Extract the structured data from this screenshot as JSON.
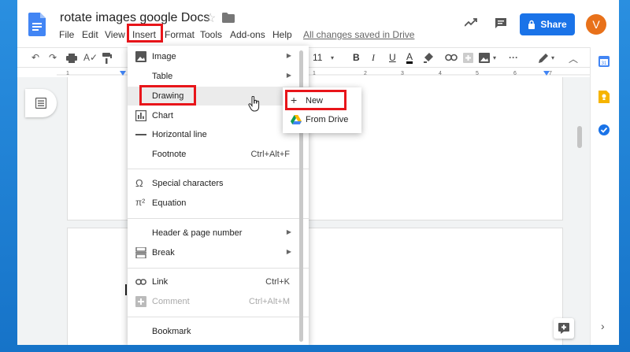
{
  "doc": {
    "title": "rotate images google Docs",
    "saved_status": "All changes saved in Drive"
  },
  "menubar": [
    "File",
    "Edit",
    "View",
    "Insert",
    "Format",
    "Tools",
    "Add-ons",
    "Help"
  ],
  "share": {
    "label": "Share"
  },
  "avatar": {
    "letter": "V"
  },
  "toolbar": {
    "font_size": "11"
  },
  "ruler": {
    "marks": [
      "1",
      "1",
      "2",
      "3",
      "4",
      "5",
      "6",
      "7"
    ]
  },
  "insert_menu": {
    "image": "Image",
    "table": "Table",
    "drawing": "Drawing",
    "chart": "Chart",
    "horizontal_line": "Horizontal line",
    "footnote": "Footnote",
    "footnote_shortcut": "Ctrl+Alt+F",
    "special_characters": "Special characters",
    "equation": "Equation",
    "header_page_number": "Header & page number",
    "break": "Break",
    "link": "Link",
    "link_shortcut": "Ctrl+K",
    "comment": "Comment",
    "comment_shortcut": "Ctrl+Alt+M",
    "bookmark": "Bookmark"
  },
  "drawing_submenu": {
    "new": "New",
    "from_drive": "From Drive"
  },
  "colors": {
    "accent": "#1a73e8",
    "highlight": "#e8151a",
    "avatar": "#e8711a"
  }
}
